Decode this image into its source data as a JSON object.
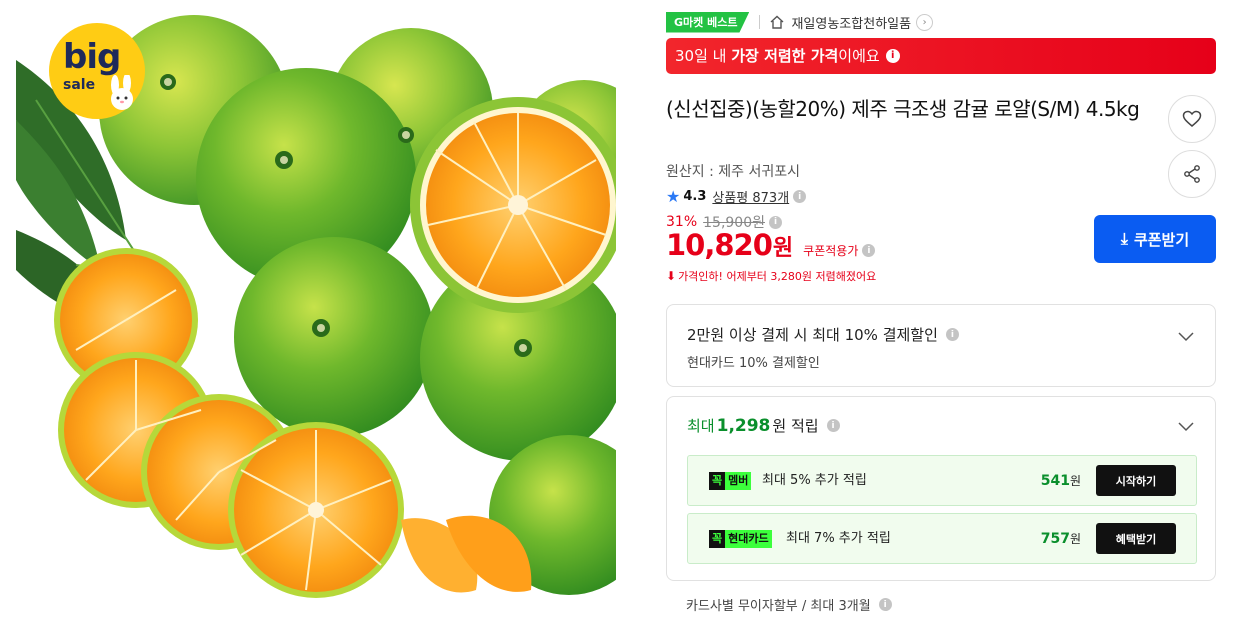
{
  "badge": {
    "big": "big",
    "sale": "sale"
  },
  "header": {
    "gmarket_badge": "G마켓 베스트",
    "store_name": "재일영농조합천하일품"
  },
  "lowest_banner": {
    "prefix": "30일 내 ",
    "bold": "가장 저렴한 가격",
    "suffix": "이에요",
    "color": "#e60019"
  },
  "product": {
    "title": "(신선집중)(농할20%) 제주 극조생 감귤 로얄(S/M) 4.5kg",
    "origin": "원산지 : 제주 서귀포시",
    "rating": "4.3",
    "reviews": "상품평 873개",
    "discount_rate": "31%",
    "original_price": "15,900원",
    "price": "10,820",
    "price_unit": "원",
    "coupon_applied_label": "쿠폰적용가",
    "price_drop_text": "가격인하! 어제부터 3,280원 저렴해졌어요"
  },
  "actions": {
    "coupon_button": "쿠폰받기",
    "accent_color": "#0a5cf2"
  },
  "card_discount": {
    "main": "2만원 이상 결제 시 최대 10% 결제할인",
    "sub": "현대카드 10% 결제할인"
  },
  "points": {
    "prefix": "최대 ",
    "amount": "1,298",
    "unit": "원 적립",
    "rows": [
      {
        "k": "꼭",
        "label": "멤버",
        "desc": "최대 5% 추가 적립",
        "amount": "541",
        "unit": "원",
        "button": "시작하기"
      },
      {
        "k": "꼭",
        "label": "현대카드",
        "desc": "최대 7% 추가 적립",
        "amount": "757",
        "unit": "원",
        "button": "혜택받기"
      }
    ]
  },
  "installment": "카드사별 무이자할부 / 최대 3개월"
}
